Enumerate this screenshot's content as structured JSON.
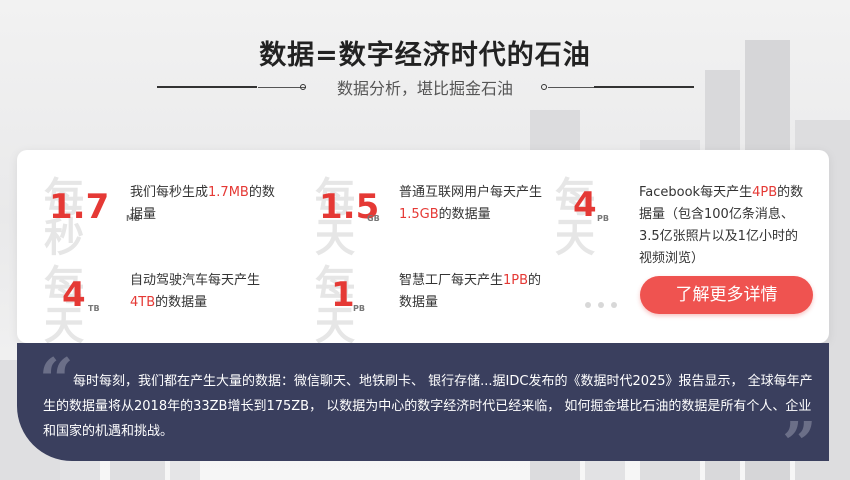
{
  "header": {
    "title": "数据=数字经济时代的石油",
    "subtitle": "数据分析，堪比掘金石油"
  },
  "stats": [
    {
      "bg_word": "每秒",
      "value": "1.7",
      "unit": "MB",
      "desc_pre": "我们每秒生成",
      "desc_hl": "1.7MB",
      "desc_post": "的数据量"
    },
    {
      "bg_word": "每天",
      "value": "1.5",
      "unit": "GB",
      "desc_pre": "普通互联网用户每天产生",
      "desc_hl": "1.5GB",
      "desc_post": "的数据量"
    },
    {
      "bg_word": "每天",
      "value": "4",
      "unit": "PB",
      "desc_pre": "Facebook每天产生",
      "desc_hl": "4PB",
      "desc_post": "的数据量（包含100亿条消息、3.5亿张照片以及1亿小时的视频浏览）"
    },
    {
      "bg_word": "每天",
      "value": "4",
      "unit": "TB",
      "desc_pre": "自动驾驶汽车每天产生",
      "desc_hl": "4TB",
      "desc_post": "的数据量"
    },
    {
      "bg_word": "每天",
      "value": "1",
      "unit": "PB",
      "desc_pre": "智慧工厂每天产生",
      "desc_hl": "1PB",
      "desc_post": "的数据量"
    }
  ],
  "cta": {
    "label": "了解更多详情"
  },
  "quote": {
    "open_mark": "“",
    "close_mark": "”",
    "text": "每时每刻，我们都在产生大量的数据：微信聊天、地铁刷卡、 银行存储...据IDC发布的《数据时代2025》报告显示， 全球每年产生的数据量将从2018年的33ZB增长到175ZB， 以数据为中心的数字经济时代已经来临， 如何掘金堪比石油的数据是所有个人、企业和国家的机遇和挑战。"
  },
  "colors": {
    "accent": "#e53935",
    "button": "#ef5350",
    "quote_bg": "#3a3f5e"
  }
}
